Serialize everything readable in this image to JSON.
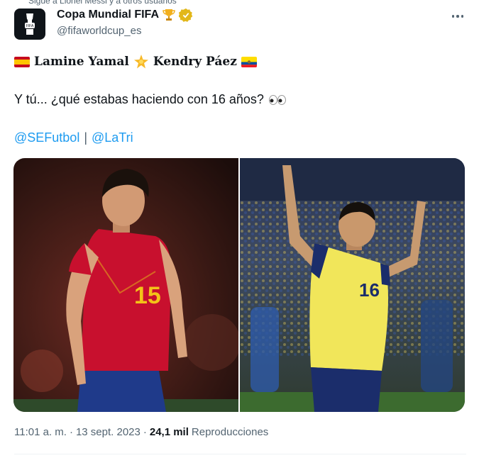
{
  "context": {
    "text": "Sigue a Lionel Messi y a otros usuarios"
  },
  "author": {
    "name": "Copa Mundial FIFA",
    "handle": "@fifaworldcup_es",
    "verified_color": "#e2b719"
  },
  "tweet": {
    "player1": "Lamine Yamal",
    "player2": "Kendry Páez",
    "question": "Y tú... ¿qué estabas haciendo con 16 años?",
    "mentions": [
      "@SEFutbol",
      "@LaTri"
    ],
    "separator": "|"
  },
  "media": {
    "left": {
      "subject": "Spain player number 15 in red shirt",
      "number": "15"
    },
    "right": {
      "subject": "Ecuador player number 16 in yellow shirt",
      "number": "16"
    }
  },
  "meta": {
    "time": "11:01 a. m.",
    "dot": "·",
    "date": "13 sept. 2023",
    "views_count": "24,1 mil",
    "views_label": "Reproducciones"
  },
  "colors": {
    "link": "#1d9bf0",
    "secondary": "#536471",
    "text": "#0f1419"
  }
}
